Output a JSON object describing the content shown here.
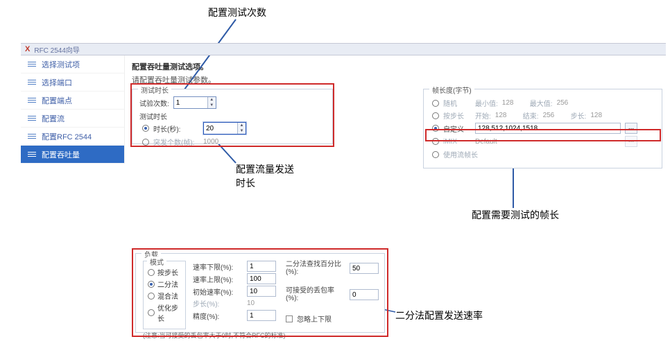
{
  "annotations": {
    "top": "配置测试次数",
    "mid_line1": "配置流量发送",
    "mid_line2": "时长",
    "right": "配置需要测试的帧长",
    "bottom": "二分法配置发送速率"
  },
  "titlebar": {
    "text": "RFC 2544向导"
  },
  "sidebar": {
    "items": [
      {
        "label": "选择测试项"
      },
      {
        "label": "选择端口"
      },
      {
        "label": "配置端点"
      },
      {
        "label": "配置流"
      },
      {
        "label": "配置RFC 2544"
      },
      {
        "label": "配置吞吐量"
      }
    ]
  },
  "header": {
    "line1": "配置吞吐量测试选项。",
    "line2": "请配置吞吐量测试参数。"
  },
  "duration": {
    "title": "测试时长",
    "trials_label": "试验次数:",
    "trials_value": "1",
    "sub_title": "测试时长",
    "opt_time_label": "时长(秒):",
    "opt_time_value": "20",
    "opt_burst_label": "突发个数(帧):",
    "opt_burst_value": "1000"
  },
  "framelen": {
    "title": "帧长度(字节)",
    "opt_random": "随机",
    "min_label": "最小值:",
    "min_value": "128",
    "max_label": "最大值:",
    "max_value": "256",
    "opt_step": "按步长",
    "start_label": "开始:",
    "start_value": "128",
    "end_label": "结束:",
    "end_value": "256",
    "steplen_label": "步长:",
    "steplen_value": "128",
    "opt_custom": "自定义",
    "custom_value": "128,512,1024,1518",
    "ellipsis": "...",
    "opt_imix": "iMIX",
    "imix_value": "Default",
    "opt_streamlen": "使用流帧长"
  },
  "load": {
    "title": "负载",
    "mode_title": "模式",
    "modes": [
      {
        "label": "按步长",
        "checked": false
      },
      {
        "label": "二分法",
        "checked": true
      },
      {
        "label": "混合法",
        "checked": false
      },
      {
        "label": "优化步长",
        "checked": false
      }
    ],
    "rate_lower_label": "速率下限(%):",
    "rate_lower_value": "1",
    "rate_upper_label": "速率上限(%):",
    "rate_upper_value": "100",
    "init_rate_label": "初始速率(%):",
    "init_rate_value": "10",
    "step_label": "步长(%):",
    "step_value": "10",
    "precision_label": "精度(%):",
    "precision_value": "1",
    "binary_pct_label": "二分法查找百分比(%):",
    "binary_pct_value": "50",
    "acceptable_loss_label": "可接受的丢包率(%):",
    "acceptable_loss_value": "0",
    "ignore_limits_label": "忽略上下限",
    "note": "(注意:当可接受的丢包率大于0时,不符合RFC的标准)"
  }
}
